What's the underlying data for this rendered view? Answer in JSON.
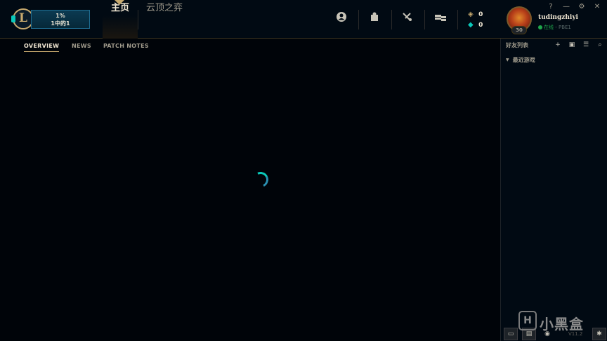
{
  "play": {
    "line1": "1%",
    "line2": "1中的1"
  },
  "nav": {
    "home": "主页",
    "tft": "云顶之弈"
  },
  "icons": [
    "profile-icon",
    "collection-icon",
    "loot-icon",
    "store-icon"
  ],
  "currency": {
    "rp": "0",
    "be": "0"
  },
  "profile": {
    "name": "tudingzhiyi",
    "level": "30",
    "status": "在线",
    "separator": " - ",
    "server": "PBE1"
  },
  "window": {
    "help": "?",
    "minimize": "—",
    "settings": "⚙",
    "close": "✕"
  },
  "subtabs": [
    "OVERVIEW",
    "NEWS",
    "PATCH NOTES"
  ],
  "friends": {
    "title": "好友列表",
    "group": "最近游戏"
  },
  "footer": {
    "version": "V11.2"
  },
  "watermark": {
    "text": "小黑盒",
    "badge": "H"
  }
}
